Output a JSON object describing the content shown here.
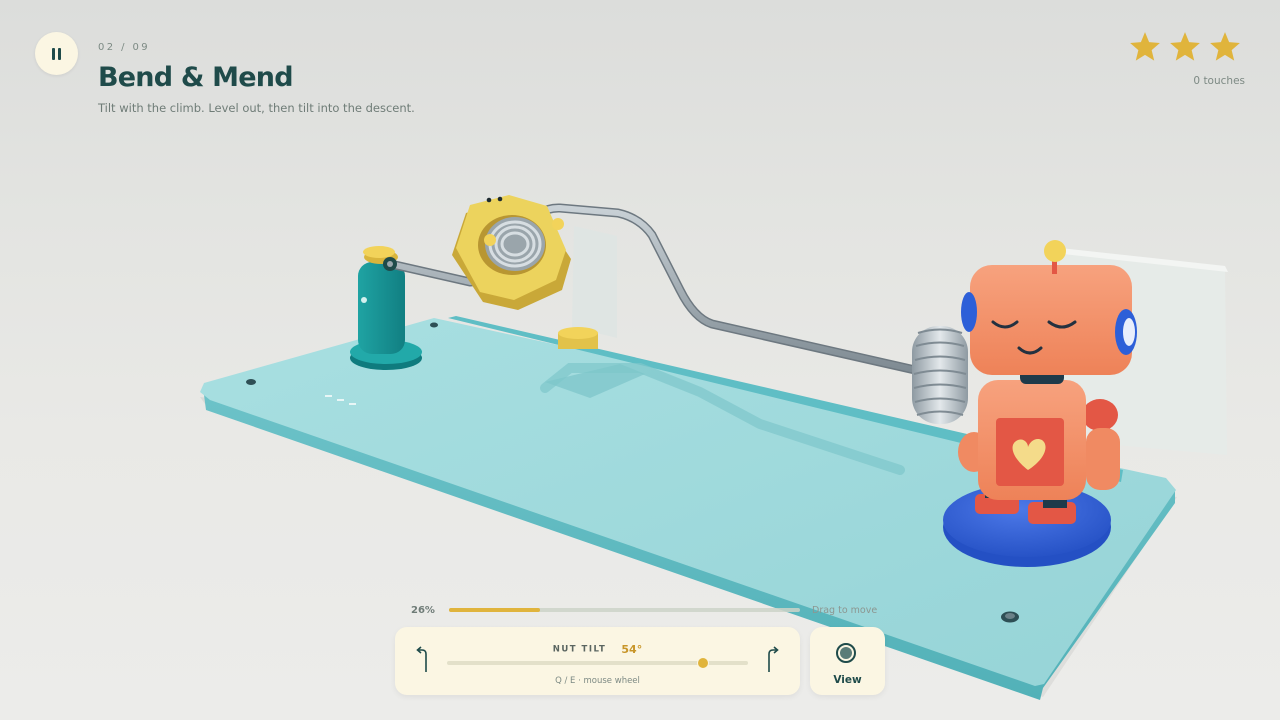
{
  "hud": {
    "level_counter": "02 / 09",
    "level_title": "Bend & Mend",
    "level_hint": "Tilt with the climb. Level out, then tilt into the descent.",
    "stars_earned": 3,
    "stars_total": 3,
    "touches_label": "0 touches"
  },
  "progress": {
    "percent_label": "26%",
    "fraction": 0.26,
    "drag_hint": "Drag to move"
  },
  "tilt": {
    "label": "NUT TILT",
    "value": "54°",
    "slider_fraction": 0.85,
    "keys_hint": "Q / E · mouse wheel"
  },
  "view_button": {
    "label": "View"
  },
  "colors": {
    "accent": "#e0b43c",
    "ink": "#1f4b4a",
    "panel": "#fbf6e3",
    "board": "#9dd9dc",
    "robot": "#f08a62",
    "nut": "#e8cd58"
  },
  "icons": {
    "pause": "pause-icon",
    "star": "star-icon",
    "tilt_left": "tilt-left-arrow-icon",
    "tilt_right": "tilt-right-arrow-icon",
    "view": "camera-view-icon"
  }
}
